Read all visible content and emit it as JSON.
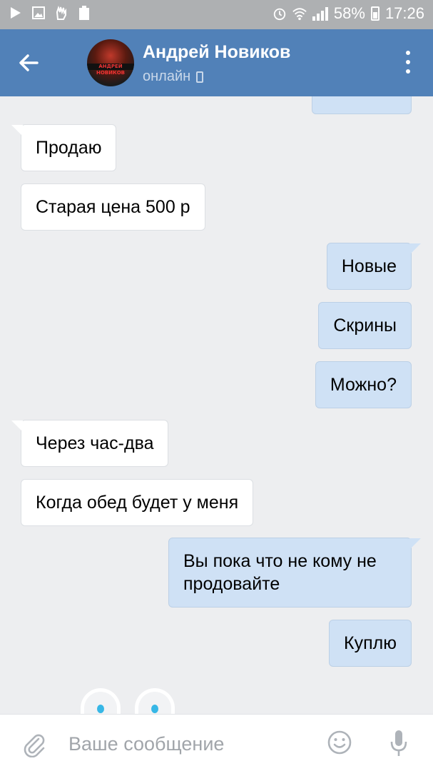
{
  "status_bar": {
    "battery_percent": "58%",
    "time": "17:26",
    "icons": [
      "play-icon",
      "image-icon",
      "hand-icon",
      "recycle-icon",
      "alarm-icon",
      "wifi-icon",
      "signal-icon",
      "battery-icon"
    ]
  },
  "header": {
    "name": "Андрей Новиков",
    "status": "онлайн",
    "avatar_text": "АНДРЕЙ НОВИКОВ"
  },
  "messages": [
    {
      "dir": "in",
      "text": "Продаю"
    },
    {
      "dir": "in",
      "text": "Старая цена 500 р"
    },
    {
      "dir": "out",
      "text": "Новые"
    },
    {
      "dir": "out",
      "text": "Скрины"
    },
    {
      "dir": "out",
      "text": "Можно?"
    },
    {
      "dir": "in",
      "text": "Через час-два"
    },
    {
      "dir": "in",
      "text": "Когда обед будет у меня"
    },
    {
      "dir": "out",
      "text": "Вы пока что не кому не продовайте"
    },
    {
      "dir": "out",
      "text": "Куплю"
    }
  ],
  "input": {
    "placeholder": "Ваше сообщение"
  },
  "colors": {
    "header": "#5181b8",
    "status_bar": "#aeb0b2",
    "background": "#edeef0",
    "outgoing_bubble": "#cfe1f5",
    "incoming_bubble": "#ffffff"
  }
}
